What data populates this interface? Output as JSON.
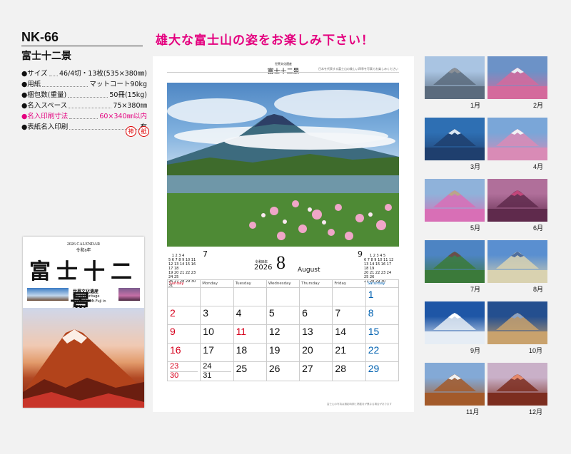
{
  "product": {
    "code": "NK-66",
    "title": "富士十二景",
    "specs": [
      {
        "label": "●サイズ",
        "value": "46/4切・13枚(535×380㎜)",
        "highlight": false
      },
      {
        "label": "●用紙",
        "value": "マットコート90kg",
        "highlight": false
      },
      {
        "label": "●梱包数(重量)",
        "value": "50冊(15kg)",
        "highlight": false
      },
      {
        "label": "●名入スペース",
        "value": "75×380㎜",
        "highlight": false
      },
      {
        "label": "●名入印刷寸法",
        "value": "60×340㎜以内",
        "highlight": true
      },
      {
        "label": "●表紙名入印刷",
        "value": "有",
        "highlight": false
      }
    ],
    "badges": [
      "神",
      "紙"
    ]
  },
  "headline": "雄大な富士山の姿をお楽しみ下さい！",
  "cover": {
    "calendar_label": "2026 CALENDAR",
    "era_label": "令和8年",
    "title": "富士十二景",
    "subtitle_jp": "世界文化遺産",
    "subtitle_en1": "World Heritage",
    "subtitle_en2": "Beautiful Mt.Fuji in Japan"
  },
  "calendar_page": {
    "brand": "富士十二景",
    "brand_small": "世界文化遺産",
    "note": "日本を代表する富士山の美しい四季を写真でお楽しみください",
    "month_number": "8",
    "era": "令和8年",
    "year": "2026",
    "month_en": "August",
    "prev_month": "7",
    "next_month": "9",
    "weekdays": [
      "Sunday",
      "Monday",
      "Tuesday",
      "Wednesday",
      "Thursday",
      "Friday",
      "Saturday"
    ],
    "weeks": [
      [
        "",
        "",
        "",
        "",
        "",
        "",
        "1"
      ],
      [
        "2",
        "3",
        "4",
        "5",
        "6",
        "7",
        "8"
      ],
      [
        "9",
        "10",
        "11",
        "12",
        "13",
        "14",
        "15"
      ],
      [
        "16",
        "17",
        "18",
        "19",
        "20",
        "21",
        "22"
      ],
      [
        "23/30",
        "24/31",
        "25",
        "26",
        "27",
        "28",
        "29"
      ]
    ],
    "holidays": [
      "11"
    ],
    "footer": "富士山の写真は撮影時期と掲載月が異なる場合があります"
  },
  "thumbnails": [
    {
      "label": "1月",
      "colors": [
        "#a9c4e2",
        "#8a8f96",
        "#5b6b7d"
      ]
    },
    {
      "label": "2月",
      "colors": [
        "#6c92c7",
        "#e9eef4",
        "#d46a9c"
      ]
    },
    {
      "label": "3月",
      "colors": [
        "#2e6fb3",
        "#d9e6f2",
        "#1f3f6e"
      ]
    },
    {
      "label": "4月",
      "colors": [
        "#7aa6d8",
        "#f1f3f6",
        "#d98bb6"
      ]
    },
    {
      "label": "5月",
      "colors": [
        "#8fb2da",
        "#b9a68a",
        "#d86fb6"
      ]
    },
    {
      "label": "6月",
      "colors": [
        "#b06f9a",
        "#c2467a",
        "#5f2a4c"
      ]
    },
    {
      "label": "7月",
      "colors": [
        "#4d84c3",
        "#6b4e4a",
        "#3b7a3a"
      ]
    },
    {
      "label": "8月",
      "colors": [
        "#5a8fd0",
        "#4f6e9d",
        "#d9d2b0"
      ]
    },
    {
      "label": "9月",
      "colors": [
        "#1e56a6",
        "#ffffff",
        "#e6edf5"
      ]
    },
    {
      "label": "10月",
      "colors": [
        "#244f8f",
        "#8aa2c4",
        "#c9a26d"
      ]
    },
    {
      "label": "11月",
      "colors": [
        "#83a9d6",
        "#f1f1f1",
        "#a35a2a"
      ]
    },
    {
      "label": "12月",
      "colors": [
        "#c9b0c8",
        "#e58a6b",
        "#7c2d1f"
      ]
    }
  ]
}
